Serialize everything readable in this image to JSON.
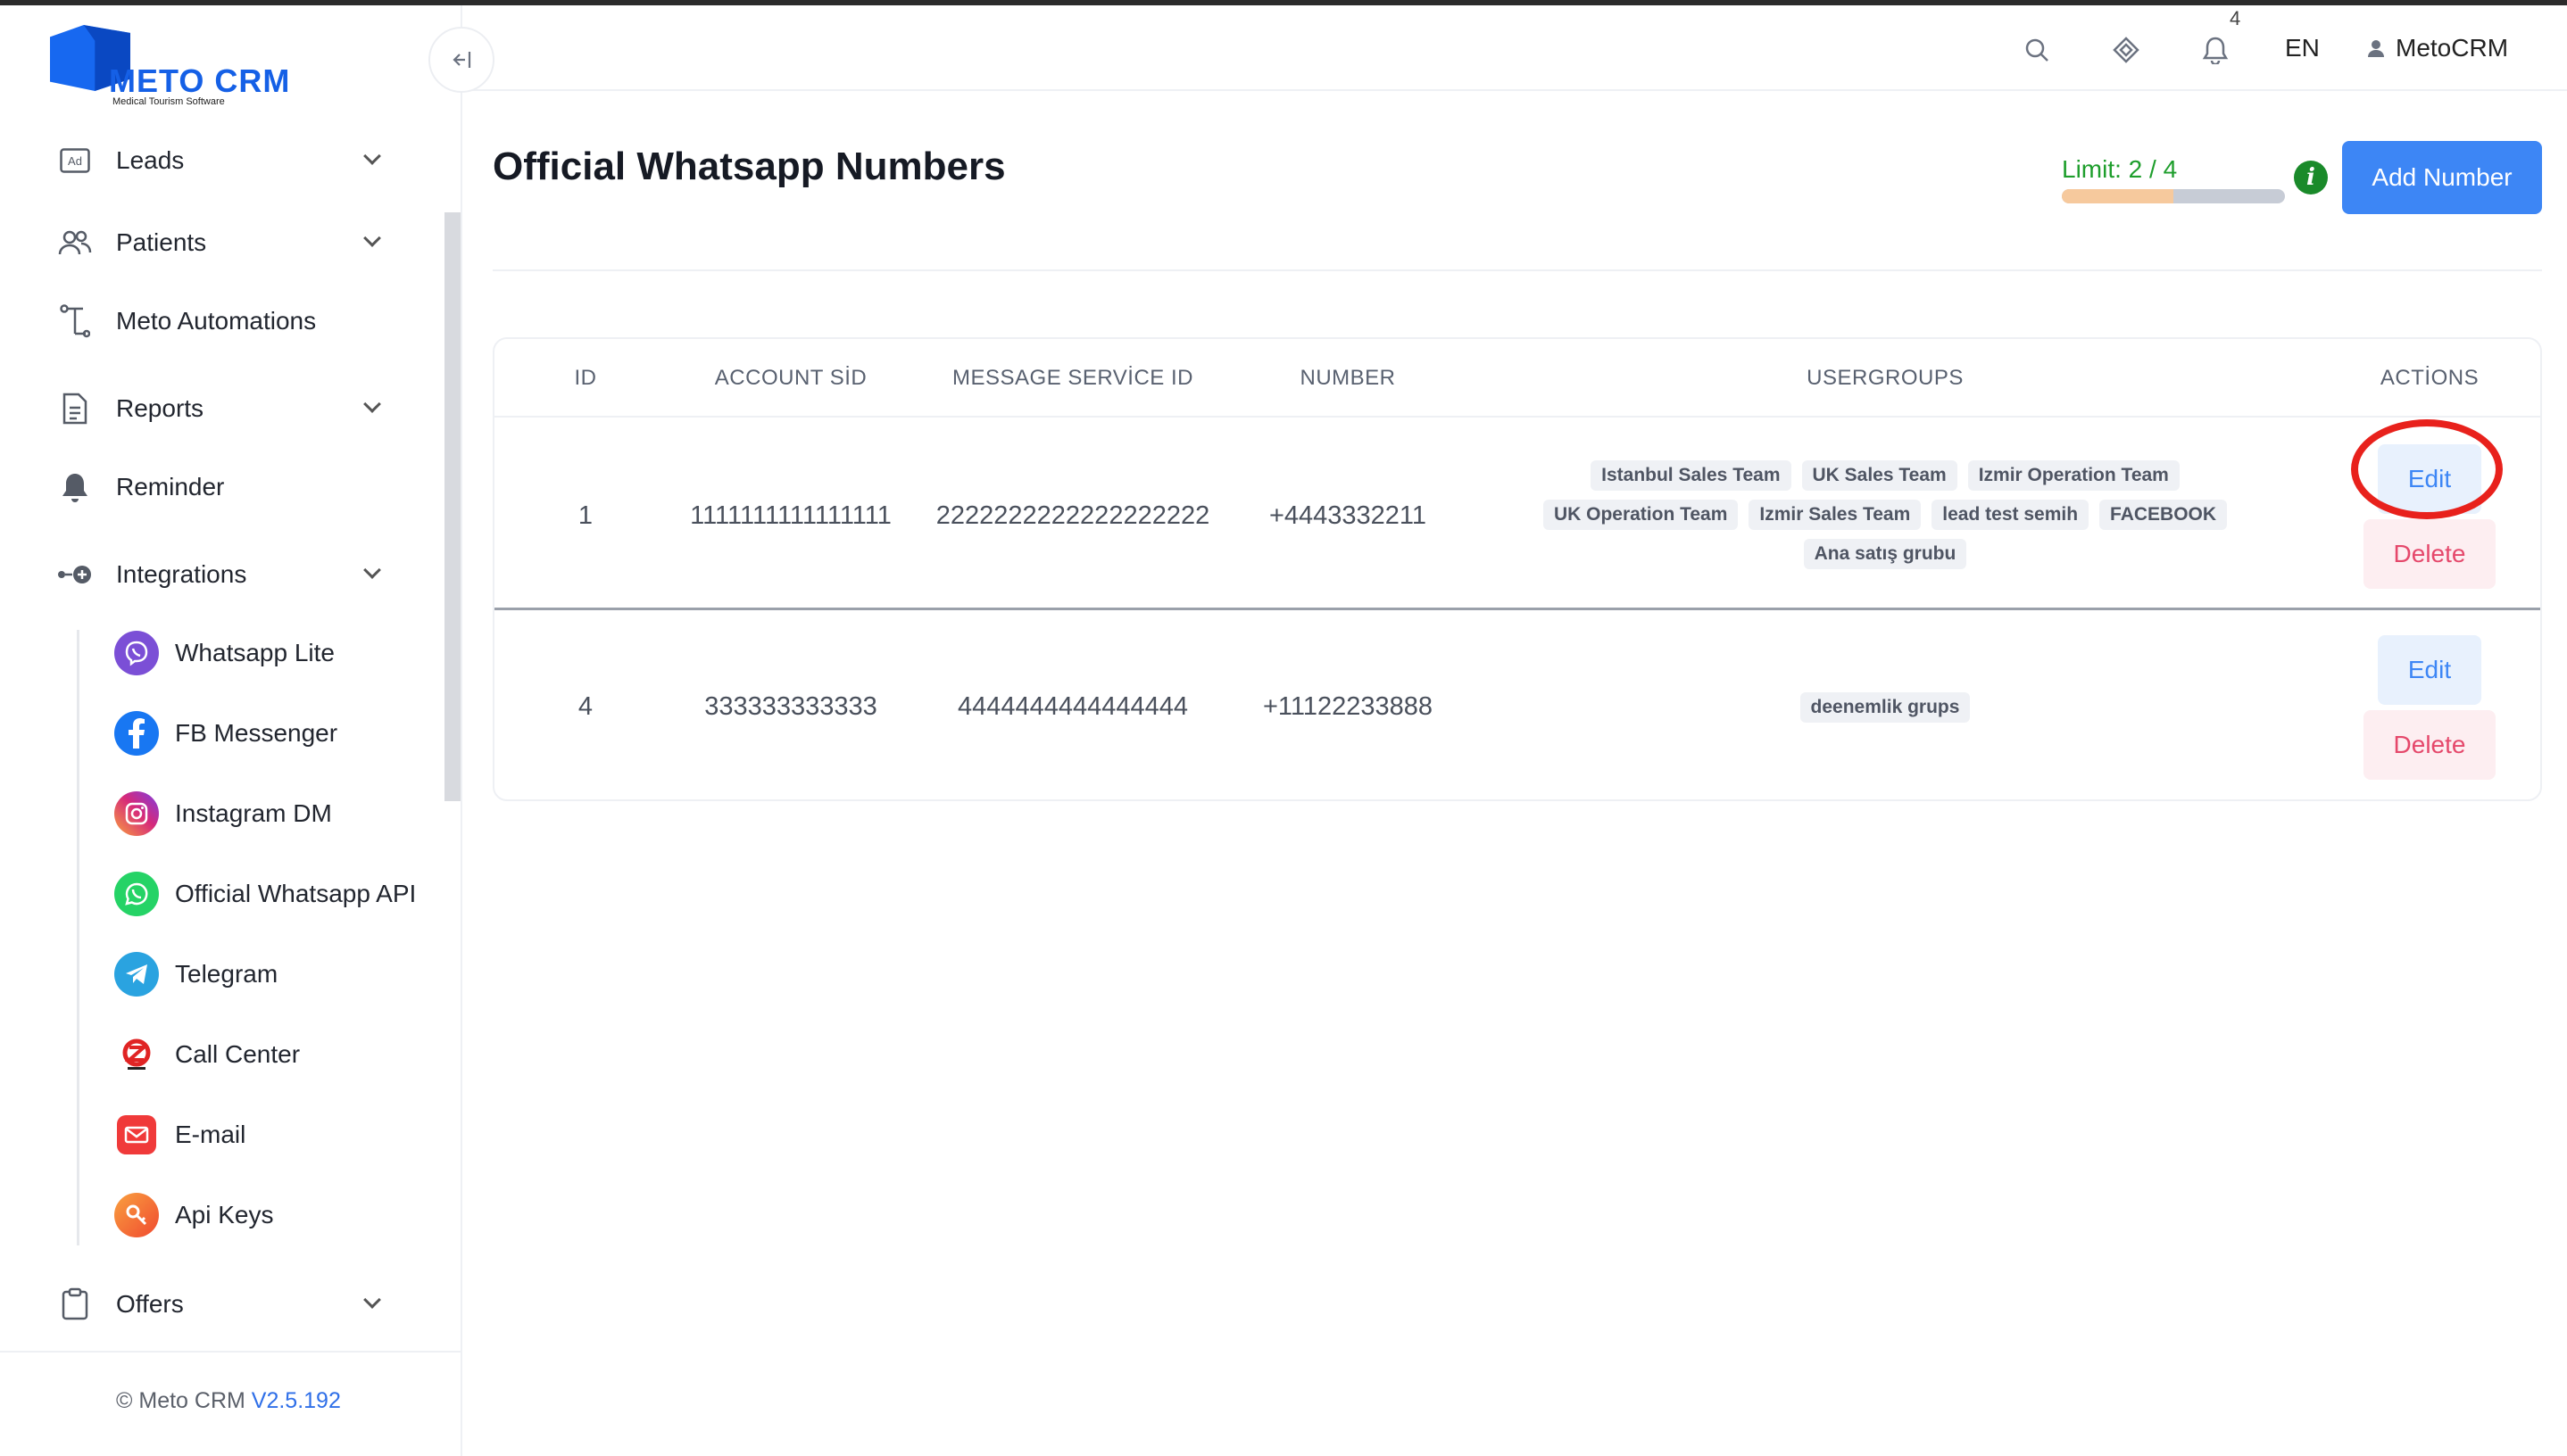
{
  "app": {
    "logo_name": "METO CRM",
    "logo_subtitle": "Medical Tourism Software"
  },
  "sidebar": {
    "collapse_icon": "collapse-left-icon",
    "items": [
      {
        "label": "Leads",
        "icon": "ad-icon",
        "expandable": true
      },
      {
        "label": "Patients",
        "icon": "users-icon",
        "expandable": true
      },
      {
        "label": "Meto Automations",
        "icon": "automation-icon",
        "expandable": false
      },
      {
        "label": "Reports",
        "icon": "report-icon",
        "expandable": true
      },
      {
        "label": "Reminder",
        "icon": "bell-icon",
        "expandable": false
      },
      {
        "label": "Integrations",
        "icon": "integration-icon",
        "expandable": true
      },
      {
        "label": "Offers",
        "icon": "clipboard-icon",
        "expandable": true
      }
    ],
    "integrations": [
      {
        "label": "Whatsapp Lite",
        "icon": "viber-icon",
        "color": "#7b4fd6"
      },
      {
        "label": "FB Messenger",
        "icon": "facebook-icon",
        "color": "#1877f2"
      },
      {
        "label": "Instagram DM",
        "icon": "instagram-icon",
        "color": "#d6297a"
      },
      {
        "label": "Official Whatsapp API",
        "icon": "whatsapp-icon",
        "color": "#25d366"
      },
      {
        "label": "Telegram",
        "icon": "telegram-icon",
        "color": "#2aa3e0"
      },
      {
        "label": "Call Center",
        "icon": "call-center-icon",
        "color": "#e02424"
      },
      {
        "label": "E-mail",
        "icon": "email-icon",
        "color": "#f03a3a"
      },
      {
        "label": "Api Keys",
        "icon": "api-key-icon",
        "color": "#f06a30"
      }
    ],
    "footer": {
      "copyright": "© Meto CRM",
      "version": "V2.5.192"
    }
  },
  "topbar": {
    "notification_count": "4",
    "language": "EN",
    "user": "MetoCRM"
  },
  "page": {
    "title": "Official Whatsapp Numbers",
    "limit_text": "Limit: 2 / 4",
    "limit_used": 2,
    "limit_total": 4,
    "add_button": "Add Number"
  },
  "table": {
    "headers": [
      "ID",
      "ACCOUNT SİD",
      "MESSAGE SERVİCE ID",
      "NUMBER",
      "USERGROUPS",
      "ACTİONS"
    ],
    "rows": [
      {
        "id": "1",
        "account_sid": "1111111111111111",
        "message_service_id": "2222222222222222222",
        "number": "+4443332211",
        "usergroups": [
          "Istanbul Sales Team",
          "UK Sales Team",
          "Izmir Operation Team",
          "UK Operation Team",
          "Izmir Sales Team",
          "lead test semih",
          "FACEBOOK",
          "Ana satış grubu"
        ],
        "edit": "Edit",
        "delete": "Delete"
      },
      {
        "id": "4",
        "account_sid": "333333333333",
        "message_service_id": "4444444444444444",
        "number": "+11122233888",
        "usergroups": [
          "deenemlik grups"
        ],
        "edit": "Edit",
        "delete": "Delete"
      }
    ]
  }
}
